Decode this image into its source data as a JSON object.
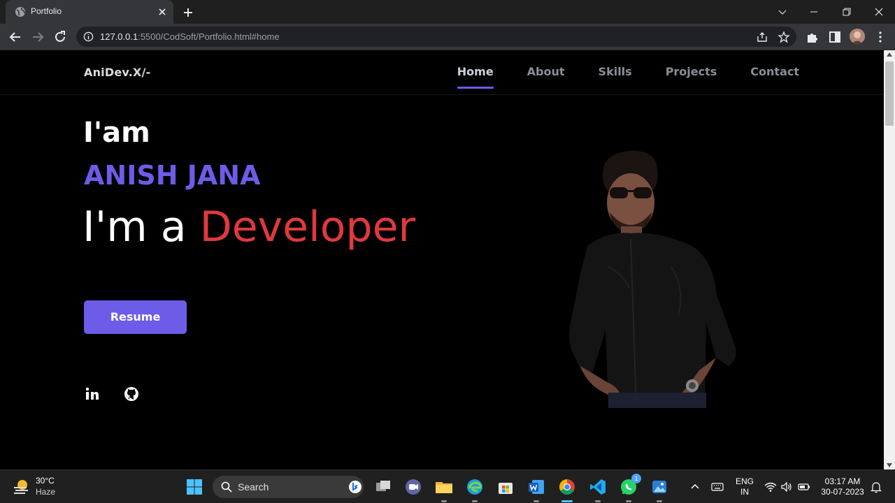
{
  "browser": {
    "tab_title": "Portfolio",
    "url_host": "127.0.0.1",
    "url_path": ":5500/CodSoft/Portfolio.html#home"
  },
  "site": {
    "logo": "AniDev.X/-",
    "nav": [
      {
        "label": "Home",
        "active": true
      },
      {
        "label": "About"
      },
      {
        "label": "Skills"
      },
      {
        "label": "Projects"
      },
      {
        "label": "Contact"
      }
    ],
    "hero": {
      "intro": "I'am",
      "name": "ANISH JANA",
      "role_prefix": "I'm a",
      "role_word": "Developer",
      "resume_label": "Resume"
    },
    "social_icons": [
      "linkedin-icon",
      "github-icon"
    ],
    "colors": {
      "accent": "#6c5ce7",
      "role_red": "#e0393e",
      "background": "#000000"
    }
  },
  "taskbar": {
    "weather_temp": "30°C",
    "weather_cond": "Haze",
    "search_label": "Search",
    "whatsapp_badge": "1",
    "lang_top": "ENG",
    "lang_bottom": "IN",
    "time": "03:17 AM",
    "date": "30-07-2023"
  }
}
